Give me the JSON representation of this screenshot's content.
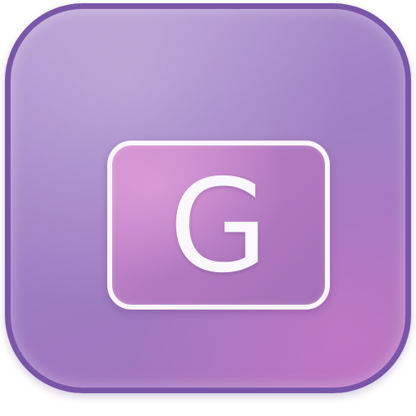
{
  "icon": {
    "letter": "G",
    "colors": {
      "border": "#7a56a8",
      "background_top": "#b59ad2",
      "background_bottom": "#a874be",
      "badge_fill": "#b279c0",
      "badge_border": "#fbf6fd",
      "letter": "#fbf8fd"
    }
  }
}
